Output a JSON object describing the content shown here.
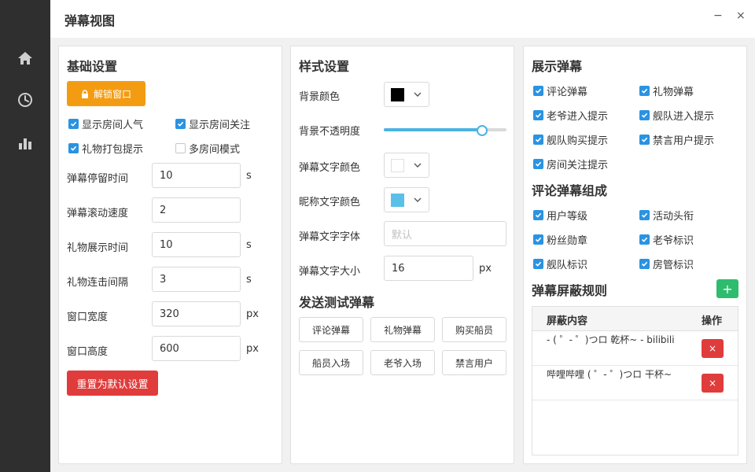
{
  "window": {
    "title": "弹幕视图",
    "minimize": "−",
    "close": "×"
  },
  "sidebar": {
    "icons": [
      "home-icon",
      "history-icon",
      "stats-icon"
    ]
  },
  "basic": {
    "title": "基础设置",
    "unlock_label": "解锁窗口",
    "checkboxes": [
      {
        "label": "显示房间人气",
        "checked": true
      },
      {
        "label": "显示房间关注",
        "checked": true
      },
      {
        "label": "礼物打包提示",
        "checked": true
      },
      {
        "label": "多房间模式",
        "checked": false
      }
    ],
    "fields": [
      {
        "label": "弹幕停留时间",
        "value": "10",
        "unit": "s"
      },
      {
        "label": "弹幕滚动速度",
        "value": "2",
        "unit": ""
      },
      {
        "label": "礼物展示时间",
        "value": "10",
        "unit": "s"
      },
      {
        "label": "礼物连击间隔",
        "value": "3",
        "unit": "s"
      },
      {
        "label": "窗口宽度",
        "value": "320",
        "unit": "px"
      },
      {
        "label": "窗口高度",
        "value": "600",
        "unit": "px"
      }
    ],
    "reset_label": "重置为默认设置"
  },
  "style": {
    "title": "样式设置",
    "bg_color_label": "背景颜色",
    "bg_color": "#000000",
    "opacity_label": "背景不透明度",
    "opacity": 0.8,
    "text_color_label": "弹幕文字颜色",
    "text_color": "#ffffff",
    "nick_color_label": "昵称文字颜色",
    "nick_color": "#5bc0e8",
    "font_label": "弹幕文字字体",
    "font_placeholder": "默认",
    "size_label": "弹幕文字大小",
    "size_value": "16",
    "size_unit": "px",
    "test_title": "发送测试弹幕",
    "test_buttons": [
      "评论弹幕",
      "礼物弹幕",
      "购买船员",
      "船员入场",
      "老爷入场",
      "禁言用户"
    ]
  },
  "display": {
    "title": "展示弹幕",
    "items": [
      {
        "label": "评论弹幕",
        "checked": true
      },
      {
        "label": "礼物弹幕",
        "checked": true
      },
      {
        "label": "老爷进入提示",
        "checked": true
      },
      {
        "label": "舰队进入提示",
        "checked": true
      },
      {
        "label": "舰队购买提示",
        "checked": true
      },
      {
        "label": "禁言用户提示",
        "checked": true
      },
      {
        "label": "房间关注提示",
        "checked": true
      }
    ],
    "compose_title": "评论弹幕组成",
    "compose_items": [
      {
        "label": "用户等级",
        "checked": true
      },
      {
        "label": "活动头衔",
        "checked": true
      },
      {
        "label": "粉丝勋章",
        "checked": true
      },
      {
        "label": "老爷标识",
        "checked": true
      },
      {
        "label": "舰队标识",
        "checked": true
      },
      {
        "label": "房管标识",
        "checked": true
      }
    ],
    "block_title": "弹幕屏蔽规则",
    "add_label": "+",
    "table_headers": [
      "屏蔽内容",
      "操作"
    ],
    "rules": [
      {
        "text": "- ( ゜- ゜)つロ 乾杯~ - bilibili",
        "delete_label": "×"
      },
      {
        "text": "哔哩哔哩 ( ゜- ゜)つロ 干杯~",
        "delete_label": "×"
      }
    ]
  },
  "colors": {
    "accent": "#2a93e2",
    "warning": "#f39c12",
    "danger": "#e03c3c",
    "success": "#2ebd6e",
    "sidebar": "#2f2f2f",
    "slider": "#4ab3e2"
  }
}
